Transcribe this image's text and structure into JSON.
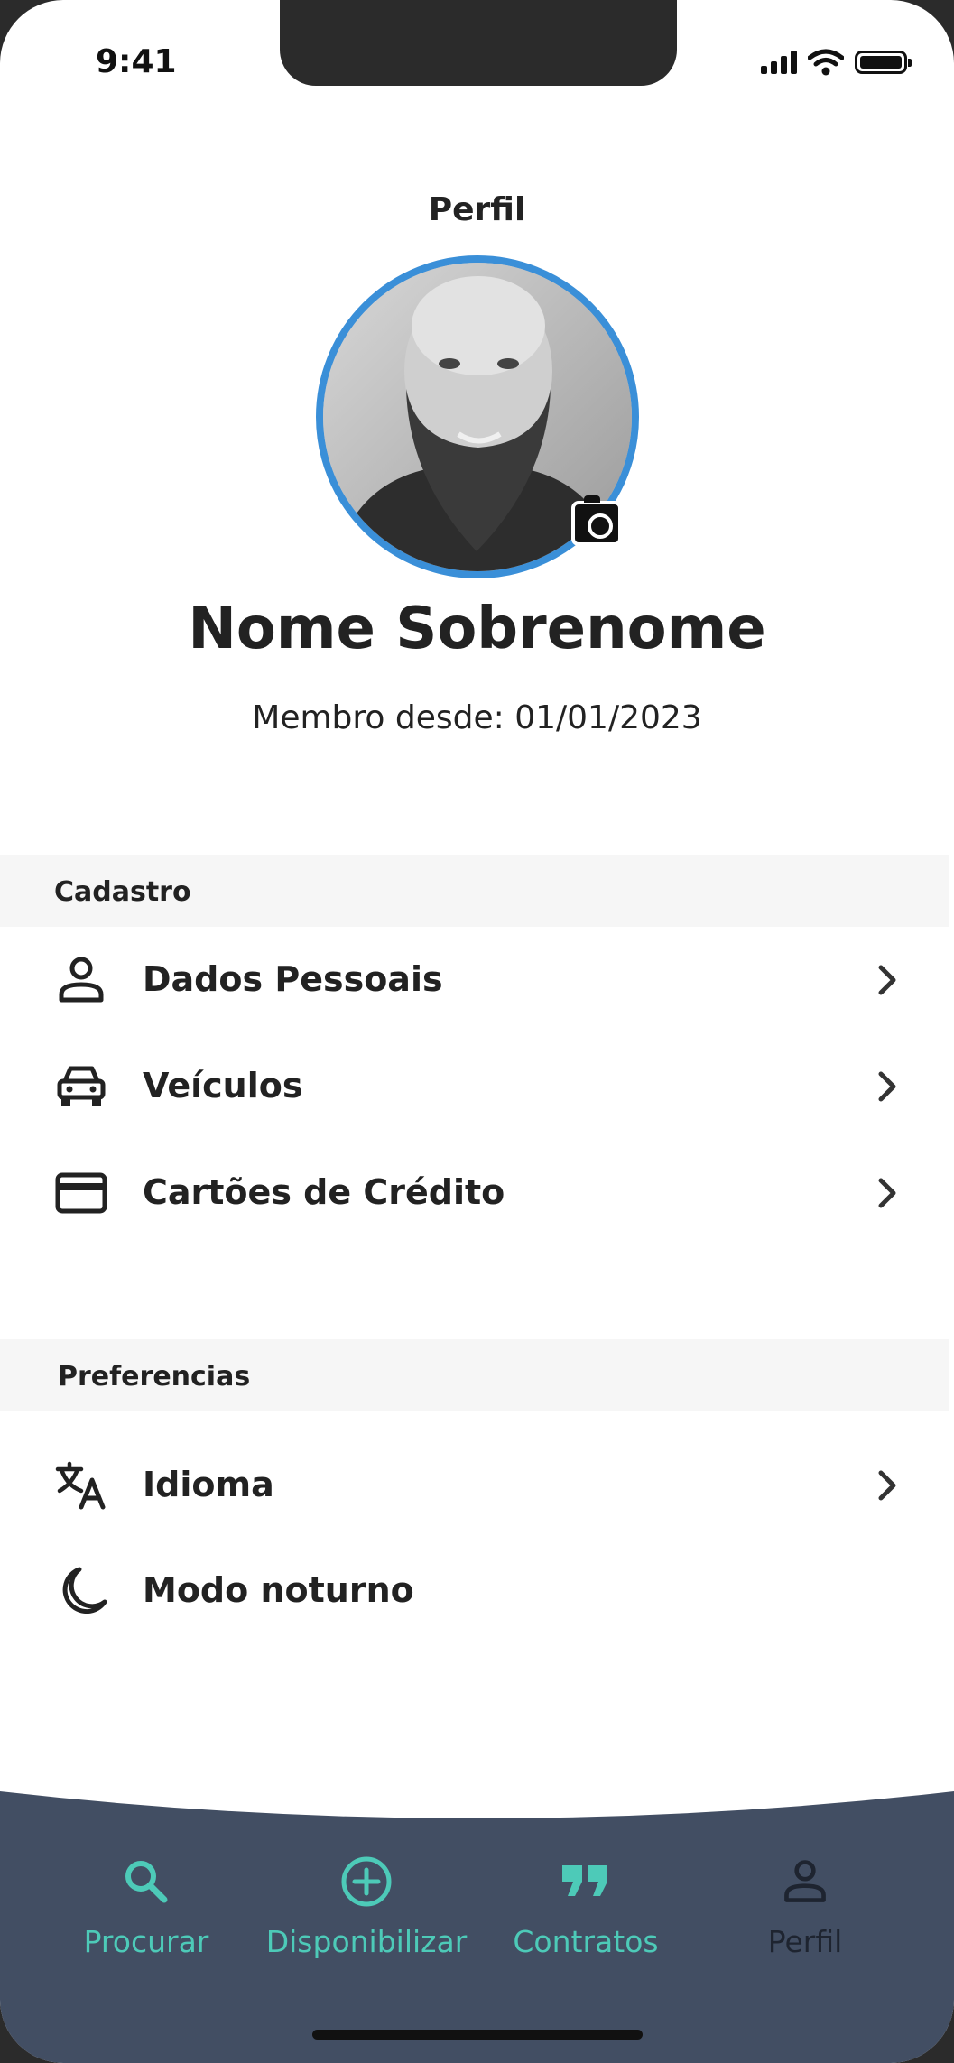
{
  "status": {
    "time": "9:41"
  },
  "header": {
    "title": "Perfil"
  },
  "profile": {
    "name": "Nome Sobrenome",
    "member_since": "Membro desde: 01/01/2023"
  },
  "sections": {
    "cadastro": {
      "title": "Cadastro",
      "items": [
        {
          "label": "Dados Pessoais",
          "icon": "person-icon"
        },
        {
          "label": "Veículos",
          "icon": "car-icon"
        },
        {
          "label": "Cartões de Crédito",
          "icon": "credit-card-icon"
        }
      ]
    },
    "preferencias": {
      "title": "Preferencias",
      "items": [
        {
          "label": "Idioma",
          "icon": "translate-icon"
        },
        {
          "label": "Modo noturno",
          "icon": "moon-icon"
        }
      ]
    }
  },
  "tabbar": {
    "items": [
      {
        "label": "Procurar",
        "icon": "search-icon"
      },
      {
        "label": "Disponibilizar",
        "icon": "plus-circle-icon"
      },
      {
        "label": "Contratos",
        "icon": "quote-icon"
      },
      {
        "label": "Perfil",
        "icon": "person-icon"
      }
    ],
    "active": "Perfil"
  },
  "colors": {
    "accent": "#4dcab8",
    "tabbar_bg": "#424e63",
    "avatar_ring": "#3a8fd8",
    "section_bg": "#f6f6f6",
    "text": "#222222"
  }
}
